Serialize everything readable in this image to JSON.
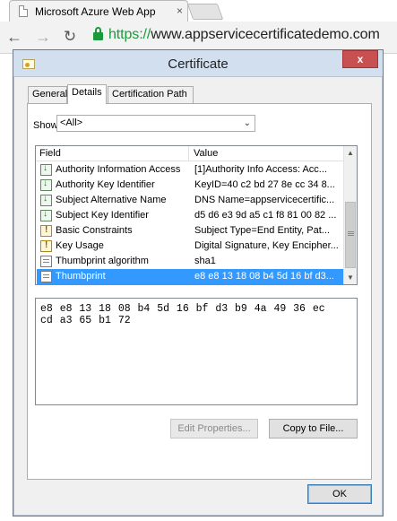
{
  "browser": {
    "tab_title": "Microsoft Azure Web App",
    "tab_close": "×",
    "url_scheme": "https://",
    "url_host": "www.appservicecertificatedemo.com"
  },
  "dialog": {
    "title": "Certificate",
    "close_label": "x",
    "tabs": [
      "General",
      "Details",
      "Certification Path"
    ],
    "show_label": "Show:",
    "show_value": "<All>",
    "columns": {
      "field": "Field",
      "value": "Value"
    },
    "rows": [
      {
        "field": "Authority Information Access",
        "value": "[1]Authority Info Access: Acc...",
        "icon": "down-arrow-icon"
      },
      {
        "field": "Authority Key Identifier",
        "value": "KeyID=40 c2 bd 27 8e cc 34 8...",
        "icon": "down-arrow-icon"
      },
      {
        "field": "Subject Alternative Name",
        "value": "DNS Name=appservicecertific...",
        "icon": "down-arrow-icon"
      },
      {
        "field": "Subject Key Identifier",
        "value": "d5 d6 e3 9d a5 c1 f8 81 00 82 ...",
        "icon": "down-arrow-icon"
      },
      {
        "field": "Basic Constraints",
        "value": "Subject Type=End Entity, Pat...",
        "icon": "warning-icon"
      },
      {
        "field": "Key Usage",
        "value": "Digital Signature, Key Encipher...",
        "icon": "warning-icon"
      },
      {
        "field": "Thumbprint algorithm",
        "value": "sha1",
        "icon": "property-icon"
      },
      {
        "field": "Thumbprint",
        "value": "e8 e8 13 18 08 b4 5d 16 bf d3...",
        "icon": "property-icon"
      }
    ],
    "selected_row": 7,
    "value_text_line1": "e8 e8 13 18 08 b4 5d 16 bf d3 b9 4a 49 36 ec",
    "value_text_line2": "cd a3 65 b1 72",
    "edit_properties_label": "Edit Properties...",
    "copy_to_file_label": "Copy to File...",
    "ok_label": "OK"
  },
  "colors": {
    "selection": "#3399ff",
    "lock": "#1b9a3b",
    "close": "#c75050"
  }
}
